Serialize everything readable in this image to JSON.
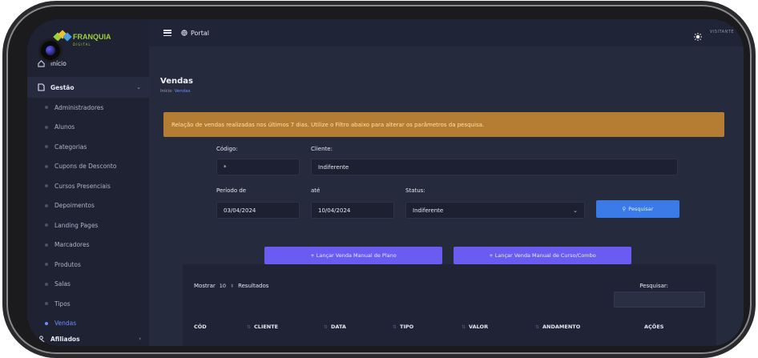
{
  "brand": {
    "name": "FRANQUIA",
    "sub": "DIGITAL",
    "colors": {
      "primary": "#9cd13a",
      "accent": "#6f8cff",
      "alert": "#b57c33"
    }
  },
  "topbar": {
    "menu_icon": "hamburger-icon",
    "portal_label": "Portal",
    "portal_icon": "globe-icon",
    "theme_icon": "sun-icon",
    "user": "VISITANTE"
  },
  "sidebar": {
    "home_label": "Início",
    "gestao": {
      "label": "Gestão",
      "icon": "file-icon"
    },
    "items": [
      {
        "label": "Administradores"
      },
      {
        "label": "Alunos"
      },
      {
        "label": "Categorias"
      },
      {
        "label": "Cupons de Desconto"
      },
      {
        "label": "Cursos Presenciais"
      },
      {
        "label": "Depoimentos"
      },
      {
        "label": "Landing Pages"
      },
      {
        "label": "Marcadores"
      },
      {
        "label": "Produtos"
      },
      {
        "label": "Salas"
      },
      {
        "label": "Tipos"
      },
      {
        "label": "Vendas",
        "active": true
      }
    ],
    "afiliados": {
      "label": "Afiliados",
      "icon": "users-icon"
    }
  },
  "page": {
    "title": "Vendas",
    "breadcrumb_home": "Início",
    "breadcrumb_current": "Vendas"
  },
  "alert": {
    "text": "Relação de vendas realizadas nos últimos 7 dias. Utilize o Filtro abaixo para alterar os parâmetros da pesquisa."
  },
  "filters": {
    "codigo": {
      "label": "Código:",
      "value": "*"
    },
    "cliente": {
      "label": "Cliente:",
      "value": "Indiferente"
    },
    "periodo_de": {
      "label": "Período de",
      "value": "03/04/2024"
    },
    "ate": {
      "label": "até",
      "value": "10/04/2024"
    },
    "status": {
      "label": "Status:",
      "value": "Indiferente"
    },
    "search_button": "Pesquisar"
  },
  "actions": {
    "manual_plano": "+ Lançar Venda Manual de Plano",
    "manual_curso": "+ Lançar Venda Manual de Curso/Combo"
  },
  "table": {
    "show_label": "Mostrar",
    "page_size": "10",
    "results_label": "Resultados",
    "search_label": "Pesquisar:",
    "columns": [
      "CÓD",
      "CLIENTE",
      "DATA",
      "TIPO",
      "VALOR",
      "ANDAMENTO",
      "AÇÕES"
    ]
  }
}
